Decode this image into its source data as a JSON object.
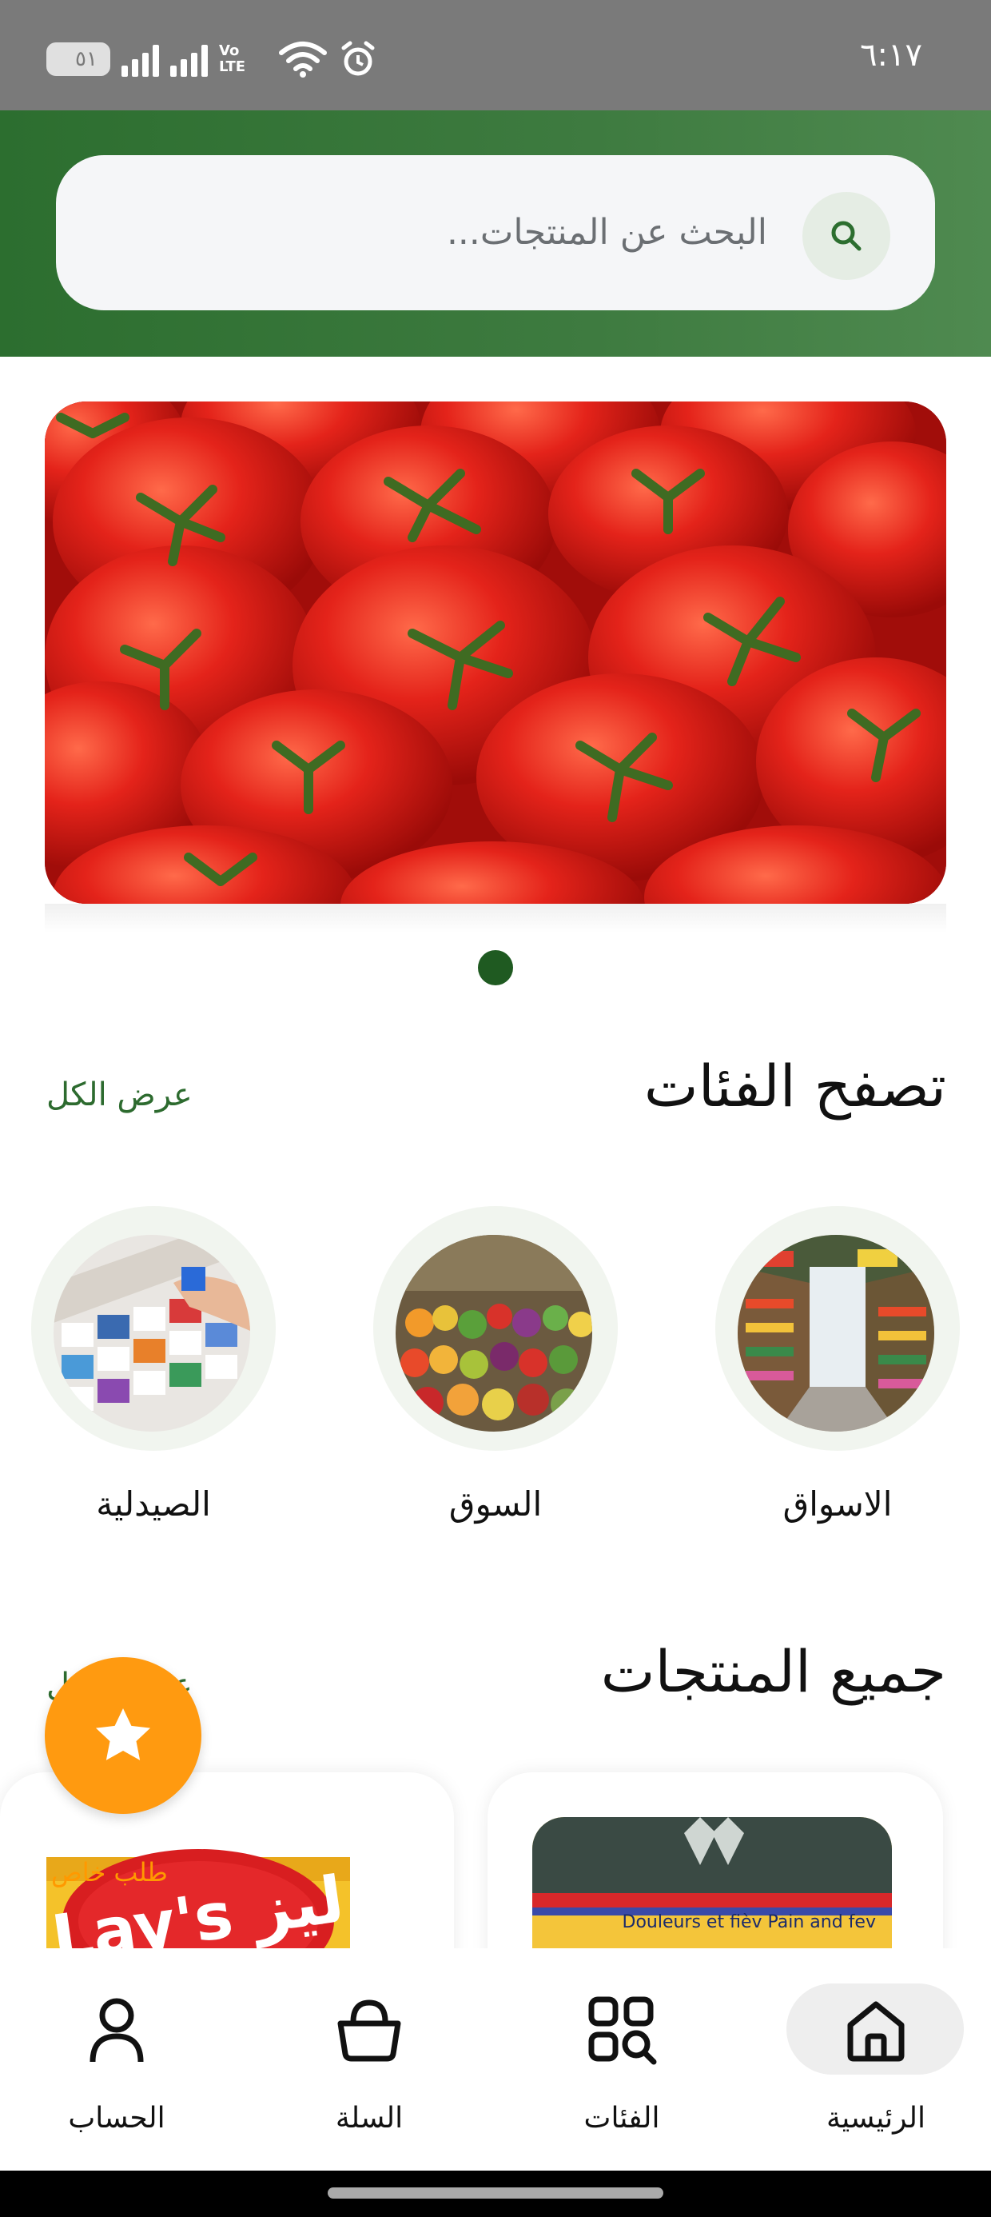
{
  "status_bar": {
    "battery_level": "٥١",
    "volte": "Vo LTE",
    "time": "٦:١٧"
  },
  "search": {
    "placeholder": "البحث عن المنتجات..."
  },
  "banner": {
    "slide_count": 1,
    "active_slide": 1
  },
  "categories_section": {
    "title": "تصفح الفئات",
    "view_all": "عرض الكل",
    "items": [
      {
        "label": "الاسواق"
      },
      {
        "label": "السوق"
      },
      {
        "label": "الصيدلية"
      }
    ]
  },
  "products_section": {
    "title": "جميع المنتجات",
    "view_all": "عرض الكل",
    "special_tag": "طلب خاص",
    "products": [
      {
        "image_text": "Douleurs et fièv Pain and fev"
      },
      {
        "image_text": "Lay's ليز"
      }
    ]
  },
  "bottom_nav": {
    "items": [
      {
        "label": "الرئيسية",
        "icon": "home-icon",
        "active": true
      },
      {
        "label": "الفئات",
        "icon": "categories-icon",
        "active": false
      },
      {
        "label": "السلة",
        "icon": "basket-icon",
        "active": false
      },
      {
        "label": "الحساب",
        "icon": "account-icon",
        "active": false
      }
    ]
  },
  "colors": {
    "primary_green": "#2c6e2f",
    "accent_orange": "#ff9a10",
    "tomato_red": "#d81e15"
  }
}
